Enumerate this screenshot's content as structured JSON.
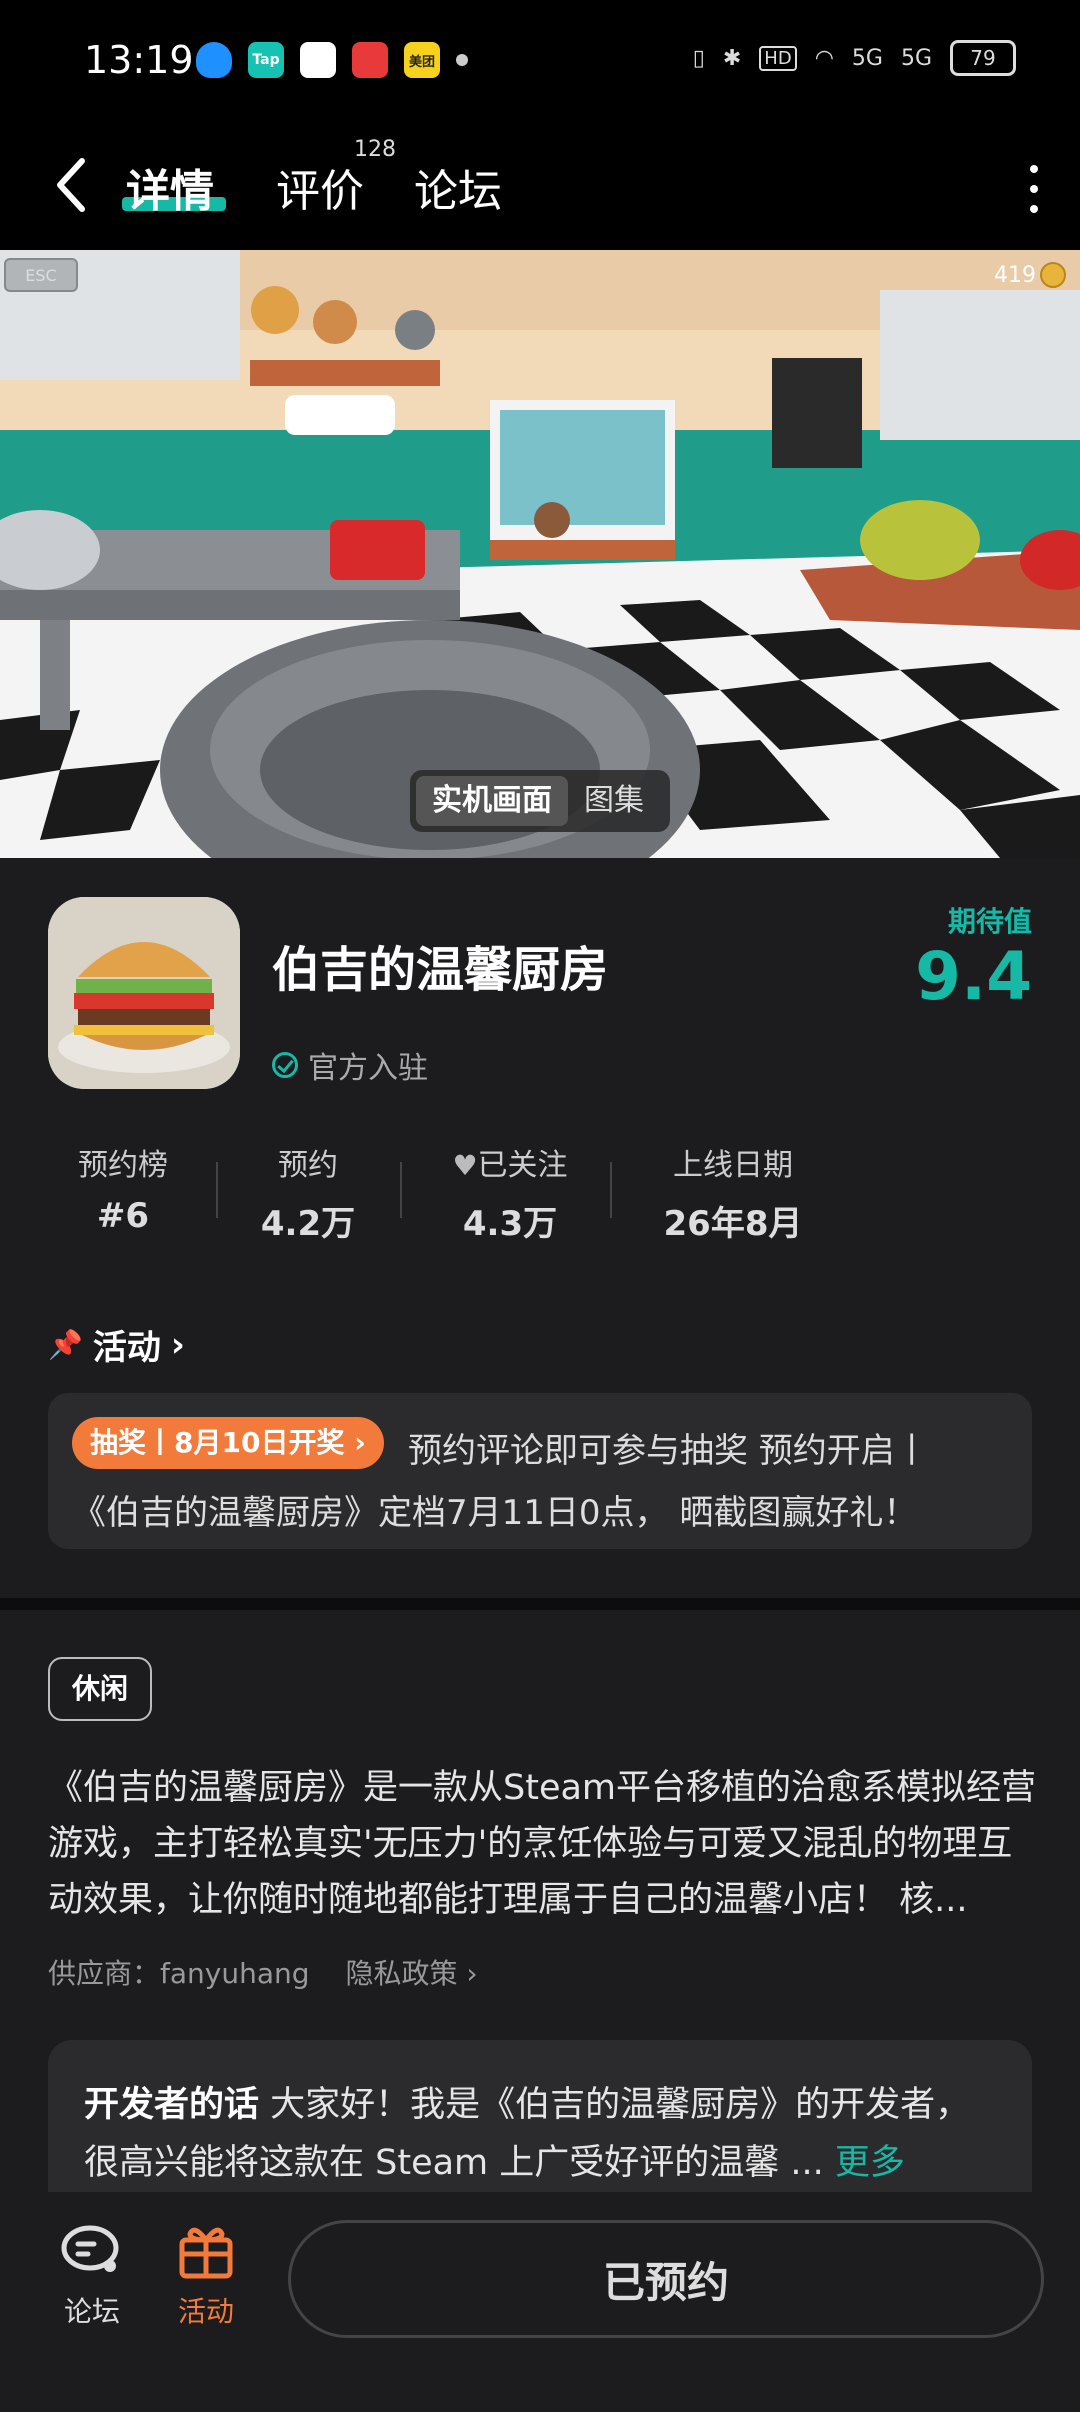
{
  "status_bar": {
    "time": "13:19",
    "apps": [
      "Tap",
      "美团"
    ],
    "battery": "79",
    "network": [
      "HD",
      "5G",
      "5G"
    ]
  },
  "header": {
    "tabs": [
      {
        "label": "详情"
      },
      {
        "label": "评价",
        "badge": "128"
      },
      {
        "label": "论坛"
      }
    ],
    "active_tab": "详情"
  },
  "hero": {
    "esc_label": "ESC",
    "coins": "419",
    "toggle": [
      "实机画面",
      "图集"
    ]
  },
  "game": {
    "name": "伯吉的温馨厨房",
    "official_label": "官方入驻",
    "expect_label": "期待值",
    "expect_value": "9.4"
  },
  "stats": [
    {
      "key": "预约榜",
      "value": "#6"
    },
    {
      "key": "预约",
      "value": "4.2万"
    },
    {
      "key": "已关注",
      "value": "4.3万"
    },
    {
      "key": "上线日期",
      "value": "26年8月"
    }
  ],
  "activity": {
    "title": "活动",
    "tag": "抽奖丨8月10日开奖 ›",
    "line1": "预约评论即可参与抽奖 预约开启丨",
    "line2": "《伯吉的温馨厨房》定档7月11日0点， 晒截图赢好礼！"
  },
  "genre": "休闲",
  "description": "《伯吉的温馨厨房》是一款从Steam平台移植的治愈系模拟经营游戏，主打轻松真实'无压力'的烹饪体验与可爱又混乱的物理互动效果，让你随时随地都能打理属于自己的温馨小店！ 核...",
  "supplier": "供应商：fanyuhang",
  "privacy": "隐私政策 ›",
  "dev_note": {
    "title": "开发者的话",
    "text": "大家好！我是《伯吉的温馨厨房》的开发者，很高兴能将这款在 Steam 上广受好评的温馨 ...",
    "more": "更多"
  },
  "bottom_nav": {
    "forum": "论坛",
    "activity": "活动",
    "reserve_button": "已预约"
  },
  "colors": {
    "accent": "#16b8a6",
    "orange": "#f27a3a",
    "bg": "#1c1c1e"
  }
}
